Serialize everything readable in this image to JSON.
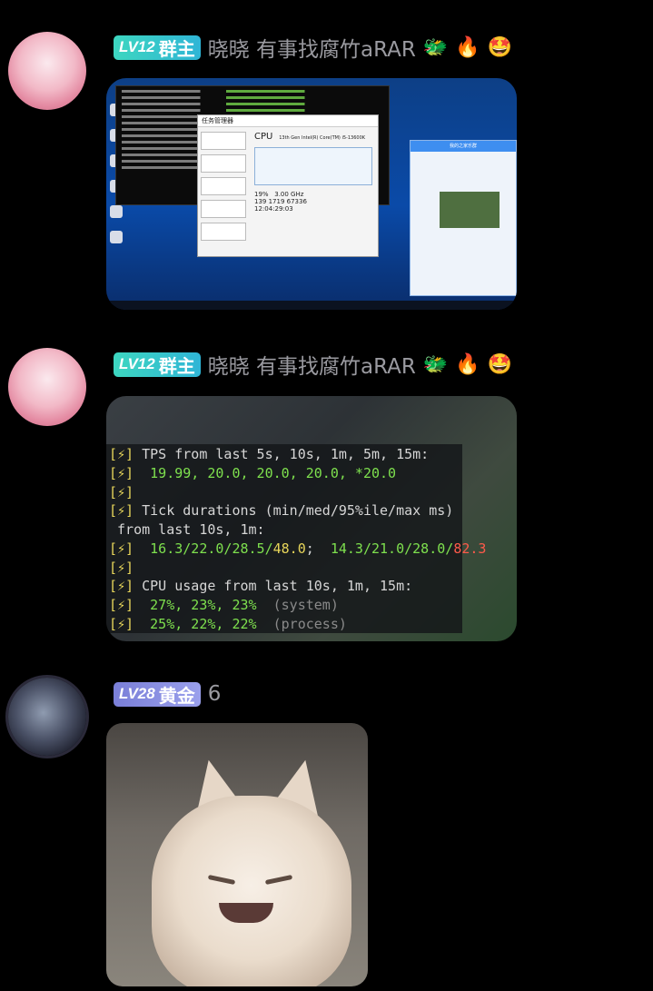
{
  "messages": [
    {
      "level": "LV12",
      "role": "群主",
      "nickname": "晓晓 有事找腐竹aRAR",
      "emojis": [
        "🐲",
        "🔥",
        "🤩"
      ],
      "content_type": "screenshot"
    },
    {
      "level": "LV12",
      "role": "群主",
      "nickname": "晓晓 有事找腐竹aRAR",
      "emojis": [
        "🐲",
        "🔥",
        "🤩"
      ],
      "content_type": "console",
      "console_lines": [
        {
          "prefix": "[⚡]",
          "text": " TPS from last 5s, 10s, 1m, 5m, 15m:"
        },
        {
          "prefix": "[⚡]",
          "text": "  19.99, 20.0, 20.0, 20.0, *20.0"
        },
        {
          "prefix": "[⚡]",
          "text": ""
        },
        {
          "prefix": "[⚡]",
          "text": " Tick durations (min/med/95%ile/max ms)"
        },
        {
          "prefix": "",
          "text": " from last 10s, 1m:"
        },
        {
          "prefix": "[⚡]",
          "text_green": "  16.3/22.0/28.5/",
          "text_yellow": "48.0",
          "text_sep": ";  ",
          "text_green2": "14.3/21.0/28.0/",
          "text_red": "82.3"
        },
        {
          "prefix": "[⚡]",
          "text": ""
        },
        {
          "prefix": "[⚡]",
          "text": " CPU usage from last 10s, 1m, 15m:"
        },
        {
          "prefix": "[⚡]",
          "text_green": "  27%, 23%, 23%",
          "text_dim": "  (system)"
        },
        {
          "prefix": "[⚡]",
          "text_green": "  25%, 22%, 22%",
          "text_dim": "  (process)"
        }
      ]
    },
    {
      "level": "LV28",
      "role": "黄金",
      "text": "6",
      "content_type": "image"
    }
  ],
  "screenshot": {
    "taskmgr_title": "任务管理器",
    "cpu_label": "CPU",
    "cpu_model": "13th Gen Intel(R) Core(TM) i5-13600K",
    "util": "19%",
    "speed": "3.00 GHz",
    "stats": "139  1719  67336",
    "uptime": "12:04:29:03",
    "chat_title": "我的之家乐群"
  }
}
